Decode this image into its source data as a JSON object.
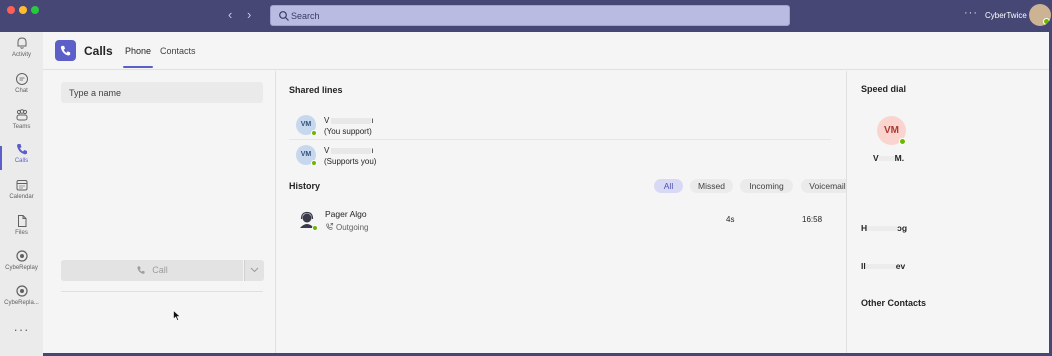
{
  "titlebar": {
    "search_placeholder": "Search",
    "more_label": "···",
    "org_name": "CyberTwice",
    "back_icon": "chevron-left-icon",
    "forward_icon": "chevron-right-icon"
  },
  "rail": {
    "items": [
      {
        "label": "Activity",
        "icon": "bell-icon"
      },
      {
        "label": "Chat",
        "icon": "chat-icon"
      },
      {
        "label": "Teams",
        "icon": "teams-icon"
      },
      {
        "label": "Calls",
        "icon": "phone-icon",
        "active": true
      },
      {
        "label": "Calendar",
        "icon": "calendar-icon"
      },
      {
        "label": "Files",
        "icon": "file-icon"
      },
      {
        "label": "CybeReplay",
        "icon": "app-icon"
      },
      {
        "label": "CybeRepla...",
        "icon": "app-icon"
      }
    ],
    "more_label": "···"
  },
  "header": {
    "title": "Calls",
    "tabs": [
      {
        "label": "Phone",
        "selected": true
      },
      {
        "label": "Contacts",
        "selected": false
      }
    ]
  },
  "dialpad": {
    "name_placeholder": "Type a name",
    "call_label": "Call"
  },
  "shared_lines": {
    "heading": "Shared lines",
    "lines": [
      {
        "initials": "VM",
        "name_initial": "V",
        "name_end": "ı",
        "subtitle": "(You support)"
      },
      {
        "initials": "VM",
        "name_initial": "V",
        "name_end": "ı",
        "subtitle": "(Supports you)"
      }
    ]
  },
  "history": {
    "heading": "History",
    "filters": [
      "All",
      "Missed",
      "Incoming",
      "Voicemail"
    ],
    "selected_filter": "All",
    "entries": [
      {
        "name": "Pager Algo",
        "direction": "Outgoing",
        "duration": "4s",
        "time": "16:58"
      }
    ]
  },
  "speed_dial": {
    "heading": "Speed dial",
    "contact": {
      "initials": "VM",
      "name_start": "V",
      "name_end": "M."
    },
    "other_a": {
      "start": "H",
      "end": "ɔg"
    },
    "other_b": {
      "start": "Il",
      "end": "ev"
    },
    "other_contacts_heading": "Other Contacts"
  },
  "colors": {
    "titlebar": "#464775",
    "accent": "#5b5fc7",
    "presence_available": "#6bb700"
  }
}
